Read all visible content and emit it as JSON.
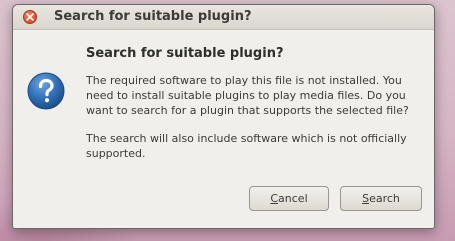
{
  "window": {
    "title": "Search for suitable plugin?"
  },
  "dialog": {
    "icon": "question-icon",
    "heading": "Search for suitable plugin?",
    "message_primary": "The required software to play this file is not installed. You need to install suitable plugins to play media files. Do you want to search for a plugin that supports the selected file?",
    "message_secondary": "The search will also include software which is not officially supported."
  },
  "buttons": {
    "cancel": {
      "mnemonic": "C",
      "rest": "ancel"
    },
    "search": {
      "mnemonic": "S",
      "rest": "earch"
    }
  },
  "colors": {
    "close_button": "#e35a36",
    "question_icon": "#2f6fb6",
    "window_background": "#f0efeb",
    "desktop_background": "#d6b5c4"
  }
}
